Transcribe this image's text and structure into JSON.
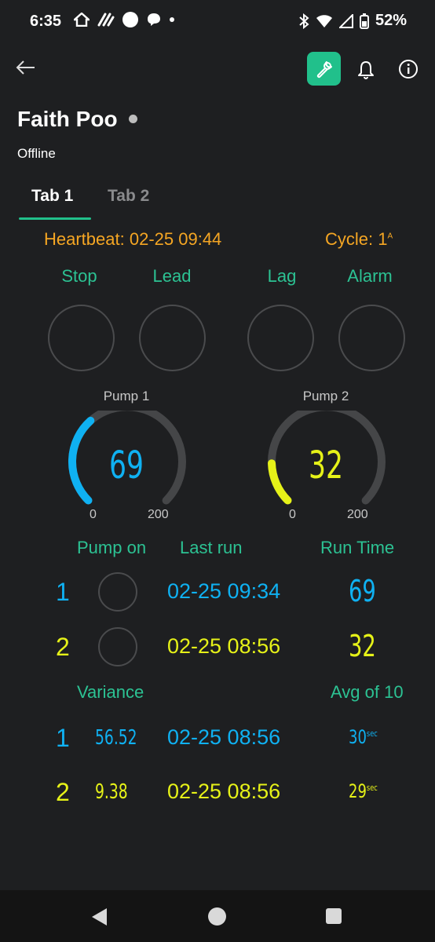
{
  "status_bar": {
    "time": "6:35",
    "battery": "52%"
  },
  "header": {
    "device_name": "Faith Poo",
    "device_status": "Offline"
  },
  "tabs": [
    {
      "label": "Tab 1",
      "active": true
    },
    {
      "label": "Tab 2",
      "active": false
    }
  ],
  "info_line": {
    "heartbeat_label": "Heartbeat:",
    "heartbeat_value": "02-25 09:44",
    "cycle_label": "Cycle:",
    "cycle_value": "1",
    "cycle_super": "A"
  },
  "indicators": [
    {
      "label": "Stop"
    },
    {
      "label": "Lead"
    },
    {
      "label": "Lag"
    },
    {
      "label": "Alarm"
    }
  ],
  "gauges": [
    {
      "title": "Pump 1",
      "value": "69",
      "min": "0",
      "max": "200",
      "level": 69,
      "color": "#0fb1f2"
    },
    {
      "title": "Pump 2",
      "value": "32",
      "min": "0",
      "max": "200",
      "level": 32,
      "color": "#e6f218"
    }
  ],
  "pump_table": {
    "headers": {
      "pump_on": "Pump on",
      "last_run": "Last run",
      "run_time": "Run Time"
    },
    "rows": [
      {
        "num": "1",
        "last_run": "02-25 09:34",
        "run_time": "69"
      },
      {
        "num": "2",
        "last_run": "02-25 08:56",
        "run_time": "32"
      }
    ]
  },
  "variance_table": {
    "headers": {
      "variance": "Variance",
      "avg": "Avg of 10"
    },
    "rows": [
      {
        "num": "1",
        "variance": "56.52",
        "date": "02-25 08:56",
        "avg": "30",
        "unit": "sec"
      },
      {
        "num": "2",
        "variance": "9.38",
        "date": "02-25 08:56",
        "avg": "29",
        "unit": "sec"
      }
    ]
  },
  "colors": {
    "accent": "#21c08b",
    "label_green": "#2cc293",
    "heartbeat_orange": "#f5a623",
    "pump1_blue": "#0fb1f2",
    "pump2_yellow": "#e6f218"
  }
}
